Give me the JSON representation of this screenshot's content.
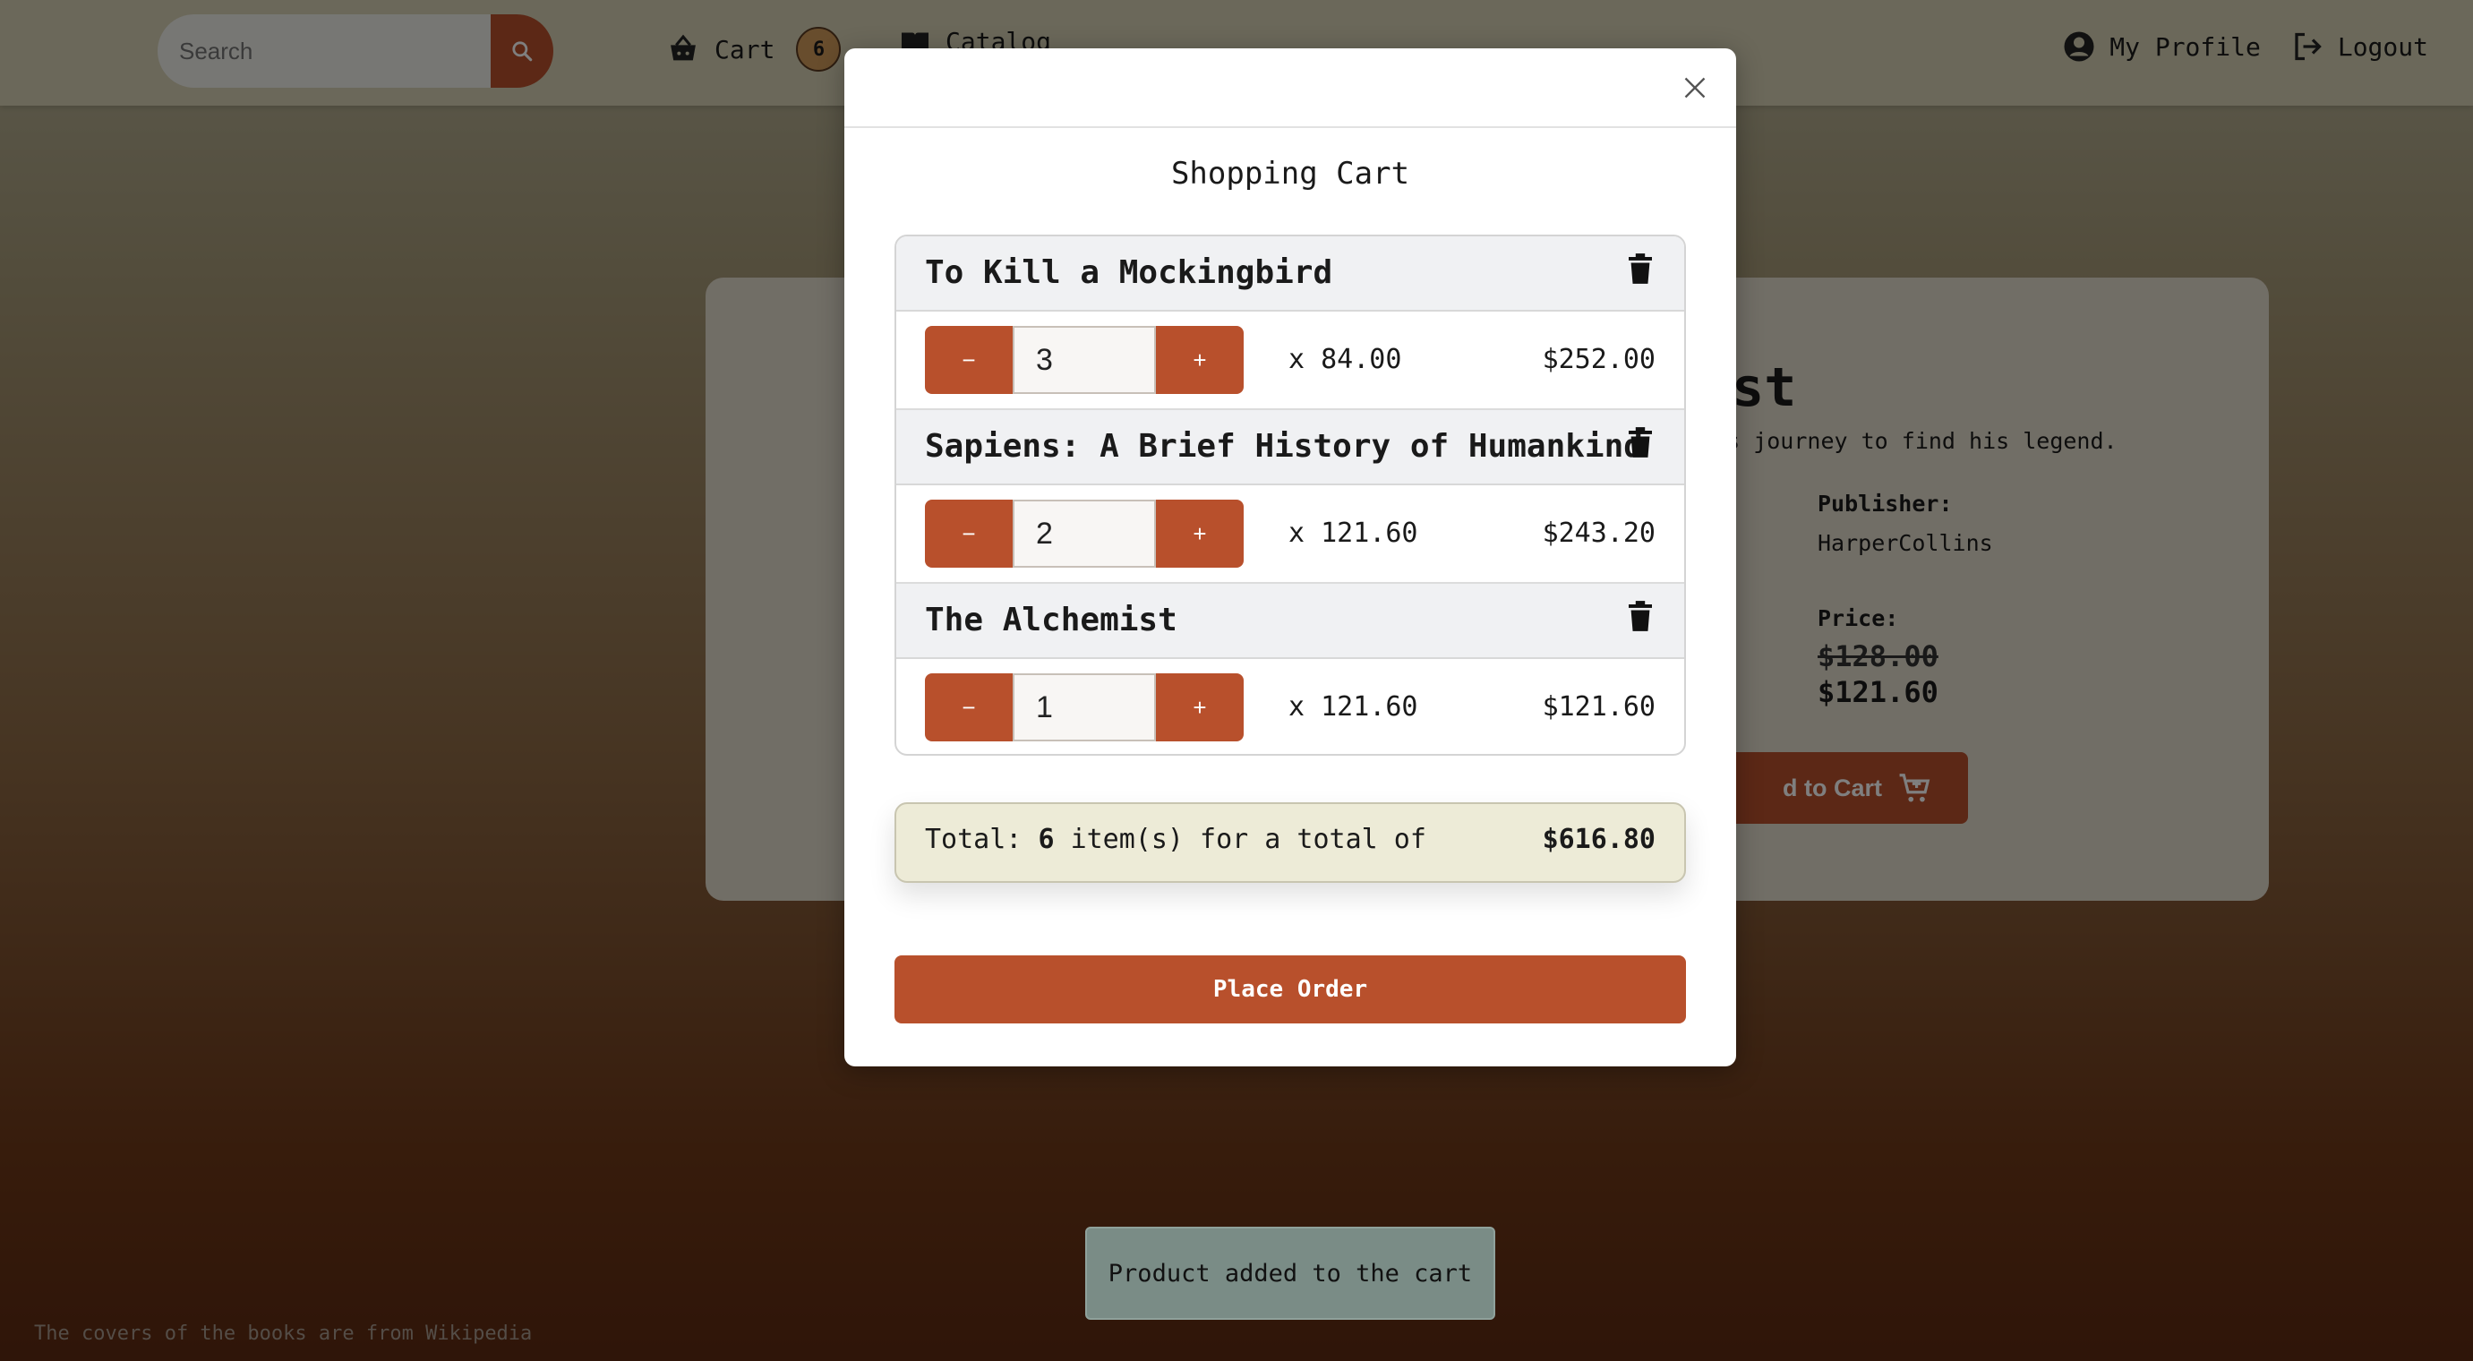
{
  "navbar": {
    "search_placeholder": "Search",
    "cart_label": "Cart",
    "cart_count": "6",
    "catalog_label": "Catalog",
    "profile_label": "My Profile",
    "logout_label": "Logout"
  },
  "product": {
    "title_visible": "ist",
    "description_visible": "d's journey to find his legend.",
    "publisher_label": "Publisher:",
    "publisher": "HarperCollins",
    "price_label": "Price:",
    "old_price": "$128.00",
    "new_price": "$121.60",
    "add_to_cart_visible": "d to Cart"
  },
  "footer_note": "The covers of the books are from Wikipedia",
  "toast": "Product added to the cart",
  "modal": {
    "title": "Shopping Cart",
    "items": [
      {
        "title": "To Kill a Mockingbird",
        "quantity": "3",
        "unit_price": "x 84.00",
        "line_total": "$252.00"
      },
      {
        "title": "Sapiens: A Brief History of Humankind",
        "quantity": "2",
        "unit_price": "x 121.60",
        "line_total": "$243.20"
      },
      {
        "title": "The Alchemist",
        "quantity": "1",
        "unit_price": "x 121.60",
        "line_total": "$121.60"
      }
    ],
    "minus_label": "−",
    "plus_label": "+",
    "total_prefix": "Total:",
    "total_count": "6",
    "total_suffix": "item(s) for a total of",
    "total_amount": "$616.80",
    "place_order_label": "Place Order"
  },
  "colors": {
    "accent": "#b8502c",
    "navbar": "#d6d1b5",
    "toast": "#7a8c86",
    "total_box": "#edebd7"
  }
}
